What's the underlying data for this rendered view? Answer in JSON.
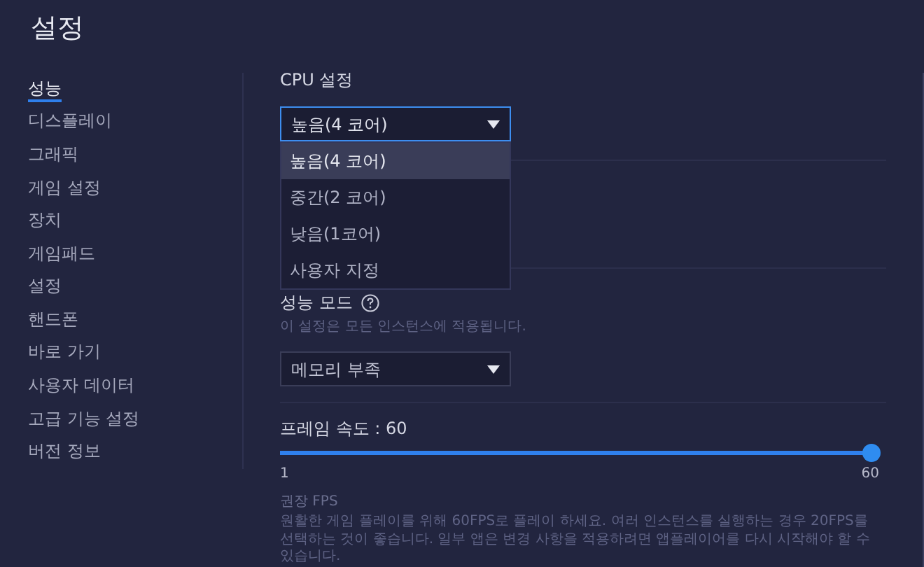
{
  "window": {
    "title": "설정"
  },
  "sidebar": {
    "items": [
      {
        "label": "성능",
        "selected": true
      },
      {
        "label": "디스플레이",
        "selected": false
      },
      {
        "label": "그래픽",
        "selected": false
      },
      {
        "label": "게임 설정",
        "selected": false
      },
      {
        "label": "장치",
        "selected": false
      },
      {
        "label": "게임패드",
        "selected": false
      },
      {
        "label": "설정",
        "selected": false
      },
      {
        "label": "핸드폰",
        "selected": false
      },
      {
        "label": "바로 가기",
        "selected": false
      },
      {
        "label": "사용자 데이터",
        "selected": false
      },
      {
        "label": "고급 기능 설정",
        "selected": false
      },
      {
        "label": "버전 정보",
        "selected": false
      }
    ]
  },
  "cpu": {
    "label": "CPU 설정",
    "dropdown": {
      "value": "높음(4 코어)",
      "expanded": true
    },
    "options": [
      {
        "label": "높음(4 코어)",
        "selected": true
      },
      {
        "label": "중간(2 코어)",
        "selected": false
      },
      {
        "label": "낮음(1코어)",
        "selected": false
      },
      {
        "label": "사용자 지정",
        "selected": false
      }
    ]
  },
  "performance_mode": {
    "label": "성능 모드",
    "description": "이 설정은 모든 인스턴스에 적용됩니다.",
    "dropdown": {
      "value": "메모리 부족"
    }
  },
  "frame_rate": {
    "label": "프레임 속도 : 60",
    "level": 1,
    "min": "1",
    "max": "60"
  },
  "recommended": {
    "title": "권장 FPS",
    "text": "원활한 게임 플레이를 위해 60FPS로 플레이 하세요. 여러 인스턴스를 실행하는 경우 20FPS를 선택하는 것이 좋습니다. 일부 앱은 변경 사항을 적용하려면 앱플레이어를 다시 시작해야 할 수 있습니다."
  }
}
